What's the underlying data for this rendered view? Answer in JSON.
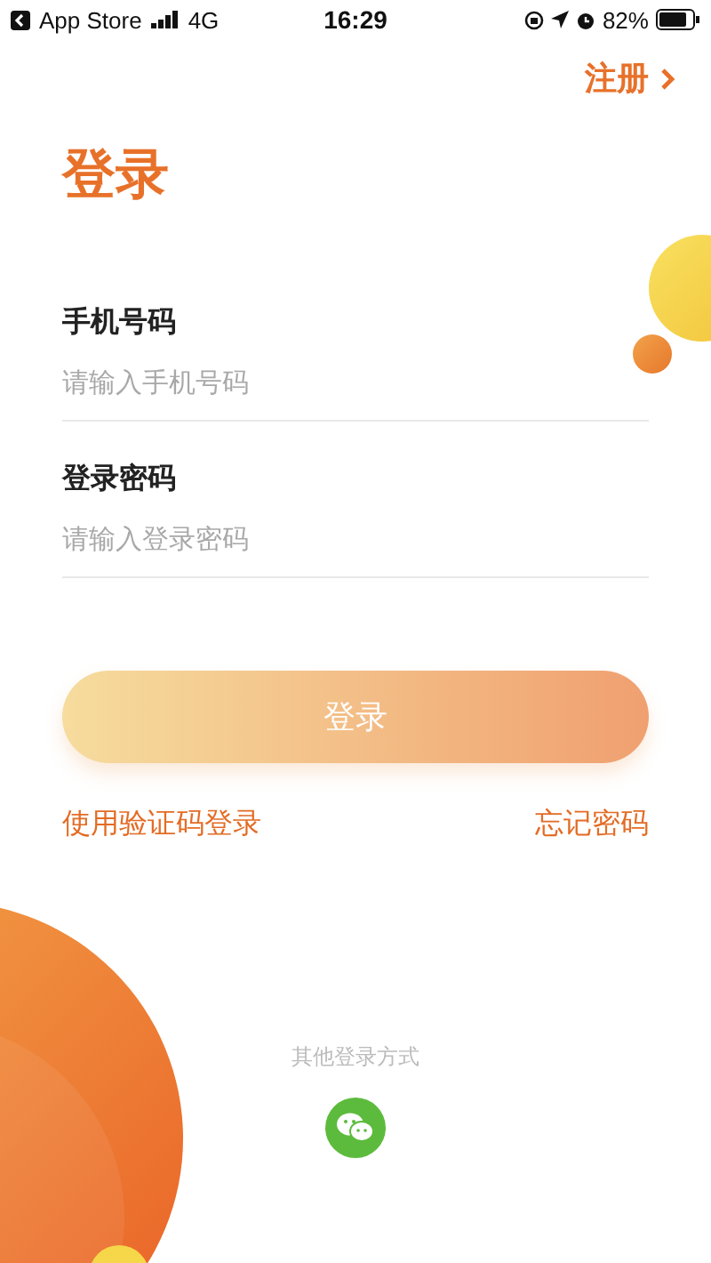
{
  "status_bar": {
    "back_label": "App Store",
    "network": "4G",
    "time": "16:29",
    "battery": "82%"
  },
  "register_link": "注册",
  "title": "登录",
  "fields": [
    {
      "label": "手机号码",
      "placeholder": "请输入手机号码"
    },
    {
      "label": "登录密码",
      "placeholder": "请输入登录密码"
    }
  ],
  "login_button": "登录",
  "sms_login_link": "使用验证码登录",
  "forgot_password_link": "忘记密码",
  "other_login": {
    "caption": "其他登录方式"
  }
}
